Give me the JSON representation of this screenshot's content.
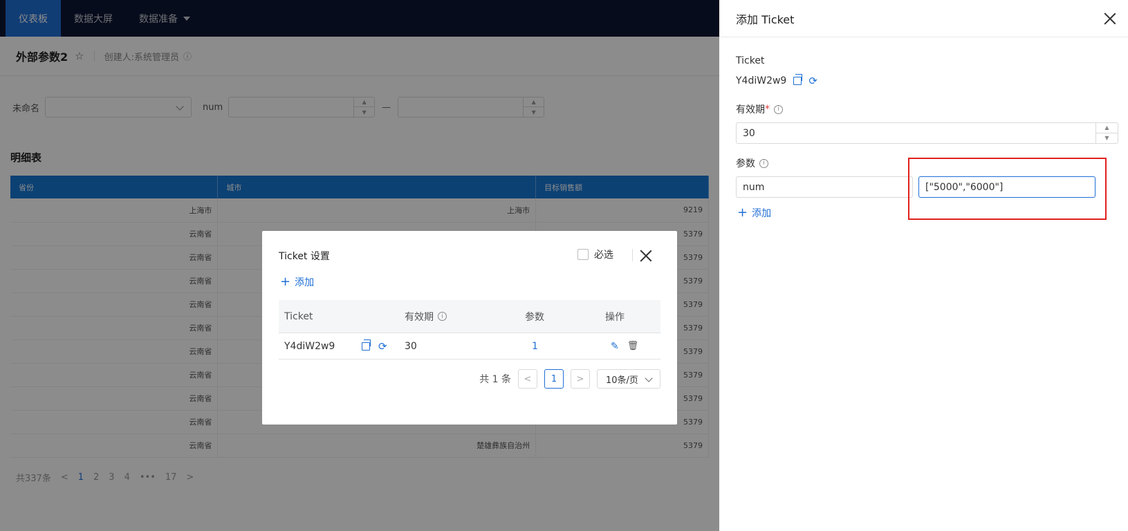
{
  "nav": {
    "tabs": [
      "仪表板",
      "数据大屏",
      "数据准备"
    ]
  },
  "page": {
    "title": "外部参数2",
    "creator": "创建人:系统管理员"
  },
  "filters": {
    "select_label": "未命名",
    "num_label": "num",
    "range_sep": "—"
  },
  "table": {
    "title": "明细表",
    "headers": [
      "省份",
      "城市",
      "目标销售额"
    ],
    "rows": [
      [
        "上海市",
        "上海市",
        "9219"
      ],
      [
        "云南省",
        "",
        "5379"
      ],
      [
        "云南省",
        "",
        "5379"
      ],
      [
        "云南省",
        "",
        "5379"
      ],
      [
        "云南省",
        "",
        "5379"
      ],
      [
        "云南省",
        "",
        "5379"
      ],
      [
        "云南省",
        "",
        "5379"
      ],
      [
        "云南省",
        "",
        "5379"
      ],
      [
        "云南省",
        "",
        "5379"
      ],
      [
        "云南省",
        "",
        "5379"
      ],
      [
        "云南省",
        "楚雄彝族自治州",
        "5379"
      ]
    ],
    "pager": {
      "total": "共337条",
      "pages": [
        "1",
        "2",
        "3",
        "4",
        "•••",
        "17"
      ],
      "prev": "<",
      "next": ">"
    }
  },
  "dialog": {
    "title": "Ticket 设置",
    "required_label": "必选",
    "add_label": "添加",
    "columns": [
      "Ticket",
      "有效期",
      "参数",
      "操作"
    ],
    "row": {
      "ticket": "Y4diW2w9",
      "validity": "30",
      "params": "1"
    },
    "pager": {
      "total": "共 1 条",
      "page": "1",
      "page_size": "10条/页",
      "prev": "<",
      "next": ">"
    }
  },
  "drawer": {
    "title": "添加 Ticket",
    "ticket_label": "Ticket",
    "ticket_value": "Y4diW2w9",
    "validity_label": "有效期",
    "required_mark": "*",
    "validity_value": "30",
    "params_label": "参数",
    "param_key": "num",
    "param_value": "[\"5000\",\"6000\"]",
    "add_label": "添加"
  },
  "colors": {
    "accent": "#1f6fd6",
    "nav_bg": "#0d1733",
    "highlight": "#e02020"
  }
}
